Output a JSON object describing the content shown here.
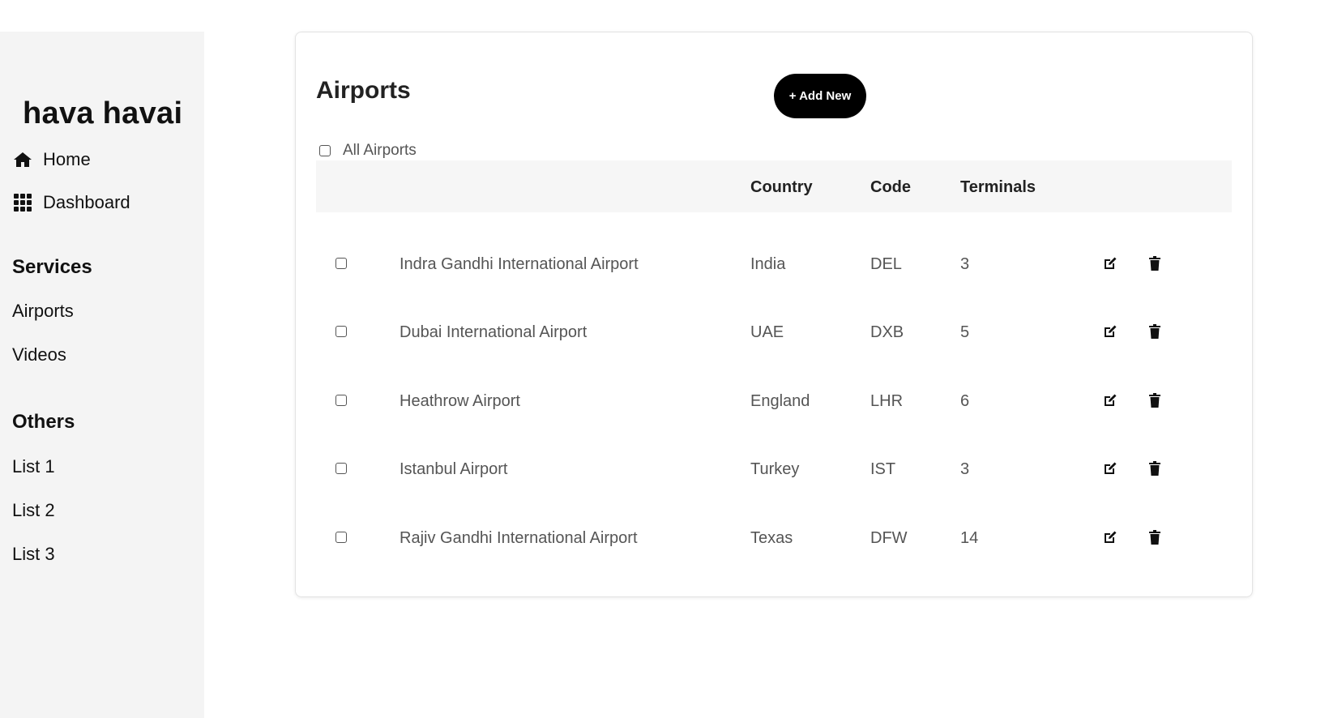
{
  "sidebar": {
    "logo": "hava havai",
    "nav": [
      {
        "label": "Home",
        "icon": "home-icon"
      },
      {
        "label": "Dashboard",
        "icon": "grid-icon"
      }
    ],
    "sections": [
      {
        "title": "Services",
        "items": [
          "Airports",
          "Videos"
        ]
      },
      {
        "title": "Others",
        "items": [
          "List 1",
          "List 2",
          "List 3"
        ]
      }
    ]
  },
  "main": {
    "title": "Airports",
    "add_button": "+ Add New",
    "select_all_label": "All Airports",
    "columns": [
      "",
      "Country",
      "Code",
      "Terminals"
    ],
    "rows": [
      {
        "name": "Indra Gandhi International Airport",
        "country": "India",
        "code": "DEL",
        "terminals": "3"
      },
      {
        "name": "Dubai International Airport",
        "country": "UAE",
        "code": "DXB",
        "terminals": "5"
      },
      {
        "name": "Heathrow Airport",
        "country": "England",
        "code": "LHR",
        "terminals": "6"
      },
      {
        "name": "Istanbul Airport",
        "country": "Turkey",
        "code": "IST",
        "terminals": "3"
      },
      {
        "name": "Rajiv Gandhi International Airport",
        "country": "Texas",
        "code": "DFW",
        "terminals": "14"
      }
    ],
    "row_actions": [
      "edit-icon",
      "trash-icon"
    ]
  },
  "colors": {
    "sidebar_bg": "#f4f4f4",
    "button_bg": "#000000",
    "header_bg": "#f6f6f6"
  }
}
